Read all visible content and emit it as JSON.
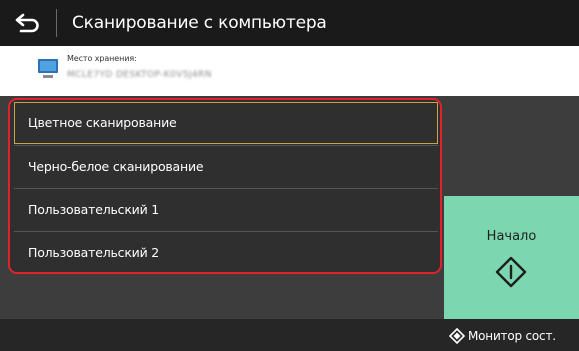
{
  "header": {
    "title": "Сканирование с компьютера",
    "back_icon": "return-arrow-icon"
  },
  "destination": {
    "label": "Место хранения:",
    "value": "MCLE7YD DESKTOP-K0V5J4RN",
    "icon": "computer-icon"
  },
  "scan_modes": [
    {
      "label": "Цветное сканирование",
      "selected": true
    },
    {
      "label": "Черно-белое сканирование",
      "selected": false
    },
    {
      "label": "Пользовательский 1",
      "selected": false
    },
    {
      "label": "Пользовательский 2",
      "selected": false
    }
  ],
  "start_button": {
    "label": "Начало",
    "icon": "start-diamond-icon",
    "color": "#7cd7b0"
  },
  "status_monitor": {
    "label": "Монитор сост.",
    "icon": "status-monitor-icon"
  },
  "colors": {
    "highlight_border": "#e0232b",
    "selected_outline": "#c8a54a"
  }
}
